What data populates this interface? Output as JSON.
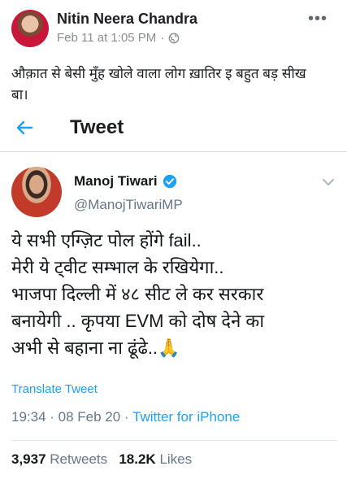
{
  "fb": {
    "author": "Nitin Neera Chandra",
    "time": "Feb 11 at 1:05 PM",
    "separator": "·",
    "more": "•••",
    "text_line1": "औक़ात से बेसी मुँह खोले वाला लोग ख़ातिर इ बहुत बड़ सीख",
    "text_line2": "बा।"
  },
  "tweet": {
    "title": "Tweet",
    "name": "Manoj Tiwari",
    "handle": "@ManojTiwariMP",
    "lines": [
      "ये सभी एग्ज़िट पोल होंगे fail..",
      "मेरी ये ट्वीट सम्भाल के रखियेगा..",
      "भाजपा दिल्ली में ४८ सीट ले कर सरकार",
      "बनायेगी .. कृपया EVM को दोष देने का",
      "अभी से बहाना ना ढूंढे..🙏"
    ],
    "translate": "Translate Tweet",
    "time": "19:34 · 08 Feb 20 · ",
    "source": "Twitter for iPhone",
    "retweets_count": "3,937",
    "retweets_label": "Retweets",
    "likes_count": "18.2K",
    "likes_label": "Likes",
    "accent": "#1da1f2"
  }
}
